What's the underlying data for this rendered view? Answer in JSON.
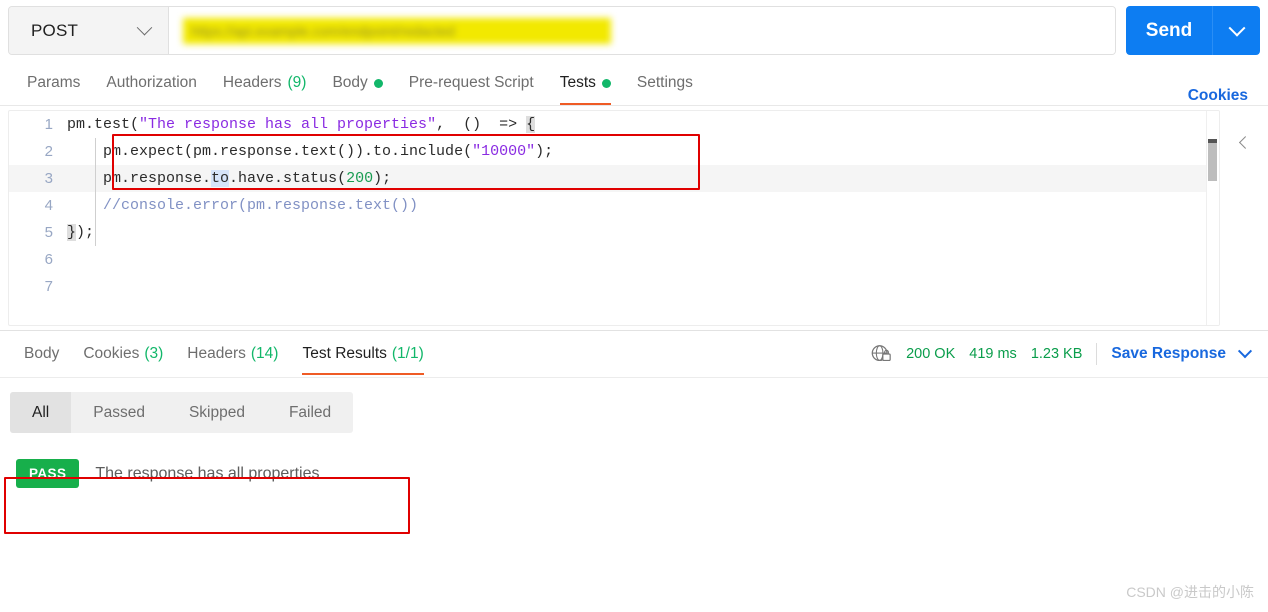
{
  "request_bar": {
    "method": "POST",
    "method_caret_icon": "chevron-down-icon",
    "url_value": "https://api.example.com/endpoint/redacted",
    "url_placeholder": "Enter request URL",
    "url_is_redacted": true,
    "send_label": "Send",
    "send_caret_icon": "chevron-down-icon",
    "send_color": "#0d7df2"
  },
  "request_tabs": {
    "items": [
      {
        "label": "Params",
        "count": "",
        "dot": false,
        "active": false
      },
      {
        "label": "Authorization",
        "count": "",
        "dot": false,
        "active": false
      },
      {
        "label": "Headers",
        "count": "(9)",
        "dot": false,
        "active": false
      },
      {
        "label": "Body",
        "count": "",
        "dot": true,
        "active": false
      },
      {
        "label": "Pre-request Script",
        "count": "",
        "dot": false,
        "active": false
      },
      {
        "label": "Tests",
        "count": "",
        "dot": true,
        "active": true
      },
      {
        "label": "Settings",
        "count": "",
        "dot": false,
        "active": false
      }
    ],
    "cookies_label": "Cookies",
    "active_underline_color": "#ef5b25",
    "count_color": "#12b76a"
  },
  "editor": {
    "collapse_icon": "chevron-left-icon",
    "lines": [
      {
        "num": "1",
        "text": "pm.test(\"The response has all properties\",  ()  => {"
      },
      {
        "num": "2",
        "text": "    pm.expect(pm.response.text()).to.include(\"10000\");"
      },
      {
        "num": "3",
        "text": "    pm.response.to.have.status(200);"
      },
      {
        "num": "4",
        "text": "    //console.error(pm.response.text())"
      },
      {
        "num": "5",
        "text": "});"
      },
      {
        "num": "6",
        "text": ""
      },
      {
        "num": "7",
        "text": ""
      }
    ]
  },
  "response_tabs": {
    "items": [
      {
        "label": "Body",
        "count": "",
        "active": false
      },
      {
        "label": "Cookies",
        "count": "(3)",
        "active": false
      },
      {
        "label": "Headers",
        "count": "(14)",
        "active": false
      },
      {
        "label": "Test Results",
        "count": "(1/1)",
        "active": true
      }
    ],
    "meta": {
      "secure_icon": "globe-lock-icon",
      "status": "200 OK",
      "time": "419 ms",
      "size": "1.23 KB",
      "save_label": "Save Response",
      "save_caret_icon": "chevron-down-icon",
      "meta_color": "#0a9d4b"
    }
  },
  "test_results": {
    "filters": [
      {
        "label": "All",
        "active": true
      },
      {
        "label": "Passed",
        "active": false
      },
      {
        "label": "Skipped",
        "active": false
      },
      {
        "label": "Failed",
        "active": false
      }
    ],
    "rows": [
      {
        "status": "PASS",
        "name": "The response has all properties",
        "status_color": "#17af4b"
      }
    ]
  },
  "annotations": {
    "highlight_color": "#e00000"
  },
  "watermark": {
    "text": "CSDN @进击的小陈"
  }
}
